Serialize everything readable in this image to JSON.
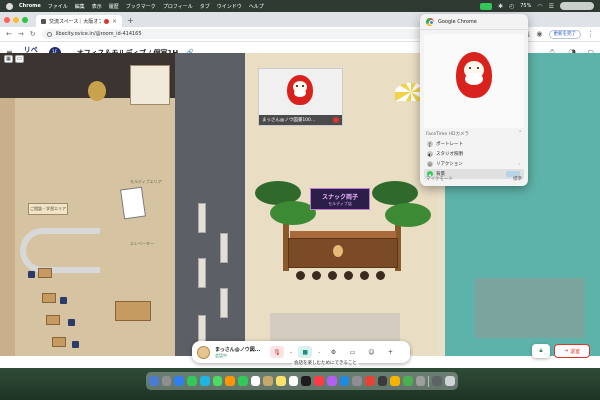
{
  "menubar": {
    "app": "Chrome",
    "items": [
      "ファイル",
      "編集",
      "表示",
      "履歴",
      "ブックマーク",
      "プロフィール",
      "タブ",
      "ウインドウ",
      "ヘルプ"
    ],
    "battery": "75%"
  },
  "browser": {
    "tab_title": "交流スペース｜大阪オフィ",
    "url": "libecity.ovice.in/@room_id-414165",
    "update_label": "更新を完了"
  },
  "app_header": {
    "logo_line1": "リベ",
    "logo_line2": "シティ",
    "floor": "1F",
    "room_title": "...オフィス＆モルディブ / 個室1H"
  },
  "map": {
    "snack_sign_title": "スナック両子",
    "snack_sign_subtitle": "モルディブ店",
    "corridor_label_1": "モルディブエリア",
    "corridor_label_2": "エレベーター",
    "room_sign": "ご相談・学習エリア"
  },
  "video_tile": {
    "name": "まっさん@ノウ図書100..."
  },
  "controls": {
    "user_name": "まっさん@ノウ図...",
    "user_status": "会話中",
    "leave_label": "退室",
    "hint": "会話を楽しむためにできること"
  },
  "camera_popover": {
    "title": "Google Chrome",
    "section": "FaceTime HDカメラ",
    "items": [
      {
        "label": "ポートレート"
      },
      {
        "label": "スタジオ照明"
      },
      {
        "label": "リアクション"
      },
      {
        "label": "背景"
      }
    ],
    "footer": "マイクモード",
    "footer_value": "標準"
  },
  "colors": {
    "accent_navy": "#1d2a6b",
    "leave_red": "#e0332f",
    "sea": "#5db3a9"
  }
}
